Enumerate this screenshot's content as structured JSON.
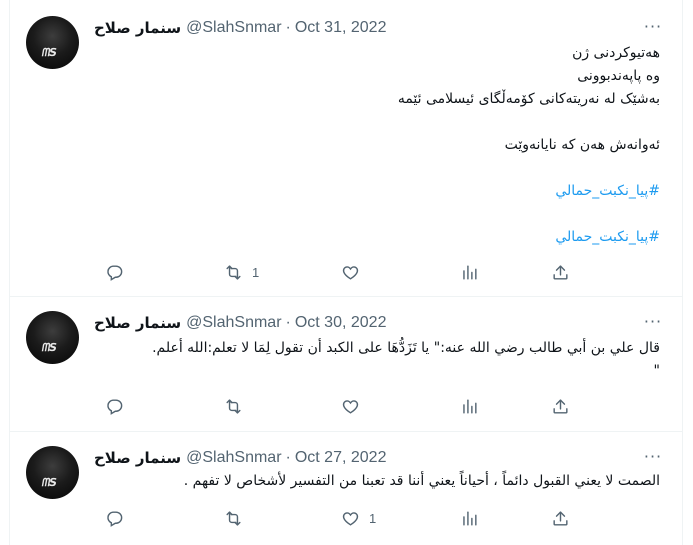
{
  "tweets": [
    {
      "name": "سنمار صلاح",
      "handle": "@SlahSnmar",
      "sep": "·",
      "date": "Oct 31, 2022",
      "more": "···",
      "lines": [
        "هەتیوکردنی ژن",
        "وە پاپەندبوونی",
        "بەشێک لە نەریتەکانی کۆمەڵگای ئیسلامی ئێمە",
        "ئەوانەش هەن کە نایانەوێت",
        "#پیا_نکبت_حمالي",
        "#پیا_نکبت_حمالي"
      ],
      "retweets": "1",
      "likes": ""
    },
    {
      "name": "سنمار صلاح",
      "handle": "@SlahSnmar",
      "sep": "·",
      "date": "Oct 30, 2022",
      "more": "···",
      "lines": [
        "قال علي بن أبي طالب رضي الله عنه:\" يا تَزَدُّهَا على الكبد أن تقول لِمَا لا تعلم:الله أعلم.",
        "\""
      ],
      "retweets": "",
      "likes": ""
    },
    {
      "name": "سنمار صلاح",
      "handle": "@SlahSnmar",
      "sep": "·",
      "date": "Oct 27, 2022",
      "more": "···",
      "lines": [
        "الصمت لا يعني القبول دائماً ، أحياناً يعني أننا قد تعبنا من التفسير لأشخاص لا تفهم ."
      ],
      "retweets": "",
      "likes": "1"
    }
  ],
  "icons": [
    "avatar",
    "more-icon",
    "reply-icon",
    "retweet-icon",
    "like-icon",
    "views-icon",
    "share-icon"
  ],
  "colors": {
    "hashtag": "#1d9bf0",
    "muted": "#536471",
    "text": "#0f1419",
    "border": "#eff3f4"
  }
}
